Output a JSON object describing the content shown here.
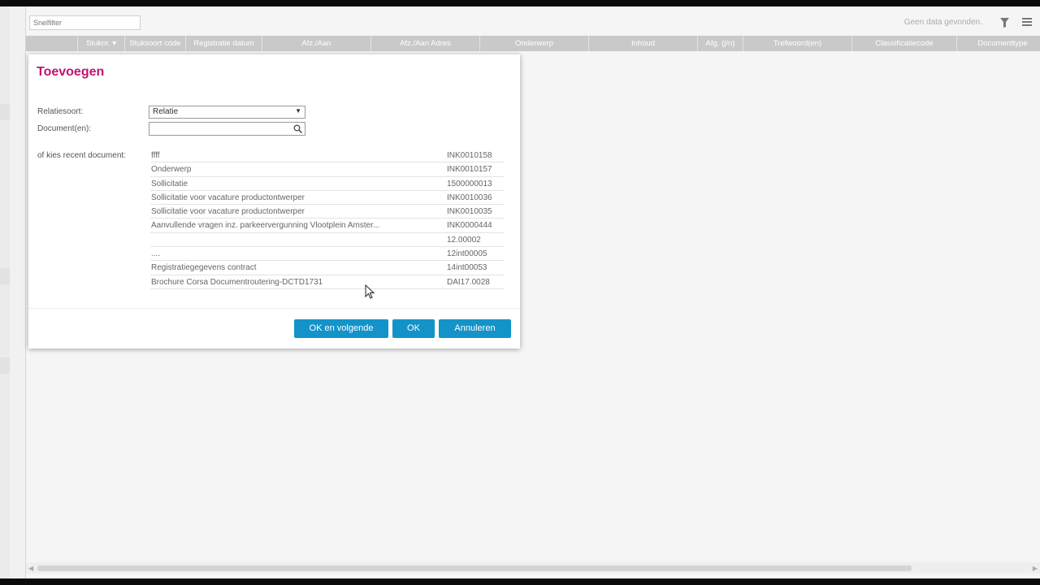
{
  "toolbar": {
    "snelfilter_placeholder": "Snelfilter",
    "no_data_text": "Geen data gevonden.",
    "filter_icon": "filter-icon",
    "menu_icon": "hamburger-menu-icon"
  },
  "grid": {
    "columns": [
      {
        "label": ""
      },
      {
        "label": "Stuknr."
      },
      {
        "label": "Stuksoort code"
      },
      {
        "label": "Registratie datum"
      },
      {
        "label": "Afz./Aan"
      },
      {
        "label": "Afz./Aan Adres"
      },
      {
        "label": "Onderwerp"
      },
      {
        "label": "Inhoud"
      },
      {
        "label": "Afg. (j/n)"
      },
      {
        "label": "Trefwoord(en)"
      },
      {
        "label": "Classificatiecode"
      },
      {
        "label": "Documenttype"
      }
    ]
  },
  "dialog": {
    "title": "Toevoegen",
    "relatiesoort_label": "Relatiesoort:",
    "relatiesoort_value": "Relatie",
    "documenten_label": "Document(en):",
    "documenten_value": "",
    "recent_label": "of kies recent document:",
    "recent": [
      {
        "subject": "ffff",
        "number": "INK0010158"
      },
      {
        "subject": "Onderwerp",
        "number": "INK0010157"
      },
      {
        "subject": "Sollicitatie",
        "number": "1500000013"
      },
      {
        "subject": "Sollicitatie voor vacature productontwerper",
        "number": "INK0010036"
      },
      {
        "subject": "Sollicitatie voor vacature productontwerper",
        "number": "INK0010035"
      },
      {
        "subject": "Aanvullende vragen inz. parkeervergunning Vlootplein Amster...",
        "number": "INK0000444"
      },
      {
        "subject": "",
        "number": "12.00002"
      },
      {
        "subject": "....",
        "number": "12int00005"
      },
      {
        "subject": "Registratiegegevens contract",
        "number": "14int00053"
      },
      {
        "subject": "Brochure Corsa Documentroutering-DCTD1731",
        "number": "DAI17.0028"
      }
    ],
    "buttons": {
      "ok_next": "OK en volgende",
      "ok": "OK",
      "cancel": "Annuleren"
    }
  },
  "colors": {
    "accent": "#c2136f",
    "button": "#1493c9",
    "grid_header": "#c9c9c9"
  }
}
